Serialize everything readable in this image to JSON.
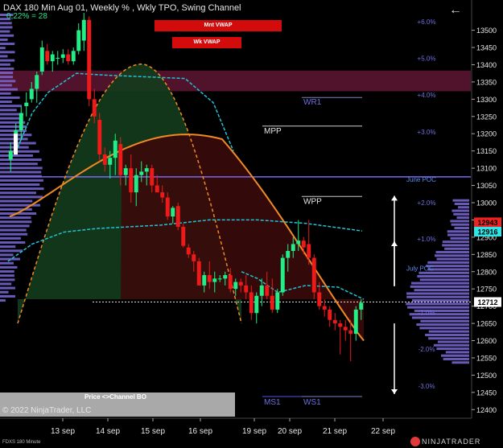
{
  "header": {
    "title": "DAX  180 Min Aug 01, Weekly % , Wkly TPO, Swing Channel",
    "subtitle": "0,22% = 28"
  },
  "buttons": {
    "mnt_vwap": "Mnt VWAP",
    "wk_vwap": "Wk VWAP"
  },
  "footer": {
    "copyright": "© 2022 NinjaTrader, LLC",
    "instrument": "FDXS 180 Minute",
    "brand": "NINJATRADER",
    "panel_label": "Price <>Channel BO"
  },
  "colors": {
    "bull": "#22ee88",
    "bear": "#ee1a1a",
    "vwap": "#25c2d6",
    "channel": "#f08a24",
    "profile": "#7b68d8",
    "zone_top": "#6b1a3a",
    "green_fill": "#133c1c",
    "red_fill": "#3a0a0a"
  },
  "chart_data": {
    "type": "candlestick",
    "x_ticks": [
      "13 sep",
      "14 sep",
      "15 sep",
      "16 sep",
      "19 sep",
      "20 sep",
      "21 sep",
      "22 sep"
    ],
    "y_ticks": [
      13500,
      13450,
      13400,
      13350,
      13300,
      13250,
      13200,
      13150,
      13100,
      13050,
      13000,
      12950,
      12900,
      12850,
      12800,
      12750,
      12700,
      12650,
      12600,
      12550,
      12500,
      12450,
      12400
    ],
    "ylim": [
      12375,
      13555
    ],
    "pct_levels": [
      {
        "label": "+6.0%",
        "value": 13525
      },
      {
        "label": "+5.0%",
        "value": 13418
      },
      {
        "label": "+4.0%",
        "value": 13312
      },
      {
        "label": "+3.0%",
        "value": 13205
      },
      {
        "label": "+2.0%",
        "value": 13000
      },
      {
        "label": "+1.0%",
        "value": 12895
      },
      {
        "label": "-1.0%",
        "value": 12682
      },
      {
        "label": "-2.0%",
        "value": 12575
      },
      {
        "label": "-3.0%",
        "value": 12468
      }
    ],
    "annotations": {
      "june_poc": {
        "label": "June POC",
        "value": 13068
      },
      "july_poc": {
        "label": "July POC",
        "value": 12810
      }
    },
    "levels": [
      {
        "label": "WR1",
        "value": 13305
      },
      {
        "label": "MPP",
        "value": 13222
      },
      {
        "label": "WPP",
        "value": 13018
      },
      {
        "label": "MS1",
        "value": 12438
      },
      {
        "label": "WS1",
        "value": 12438
      }
    ],
    "price_tags": [
      {
        "label": "12943",
        "value": 12943,
        "color": "#ee2222"
      },
      {
        "label": "12916",
        "value": 12916,
        "color": "#2ee6e6"
      },
      {
        "label": "12712",
        "value": 12712,
        "color": "#ffffff"
      }
    ],
    "purple_line": 13075,
    "zone": [
      13323,
      13383
    ],
    "last_price": 12712,
    "candles": [
      {
        "o": 13125,
        "h": 13175,
        "l": 13090,
        "c": 13150
      },
      {
        "o": 13155,
        "h": 13230,
        "l": 13150,
        "c": 13210
      },
      {
        "o": 13210,
        "h": 13280,
        "l": 13180,
        "c": 13260
      },
      {
        "o": 13280,
        "h": 13320,
        "l": 13250,
        "c": 13290
      },
      {
        "o": 13300,
        "h": 13350,
        "l": 13290,
        "c": 13330
      },
      {
        "o": 13330,
        "h": 13380,
        "l": 13290,
        "c": 13370
      },
      {
        "o": 13380,
        "h": 13470,
        "l": 13370,
        "c": 13450
      },
      {
        "o": 13440,
        "h": 13460,
        "l": 13400,
        "c": 13410
      },
      {
        "o": 13410,
        "h": 13440,
        "l": 13380,
        "c": 13430
      },
      {
        "o": 13420,
        "h": 13440,
        "l": 13400,
        "c": 13420
      },
      {
        "o": 13420,
        "h": 13445,
        "l": 13405,
        "c": 13430
      },
      {
        "o": 13430,
        "h": 13445,
        "l": 13400,
        "c": 13410
      },
      {
        "o": 13410,
        "h": 13450,
        "l": 13400,
        "c": 13440
      },
      {
        "o": 13440,
        "h": 13520,
        "l": 13430,
        "c": 13500
      },
      {
        "o": 13470,
        "h": 13550,
        "l": 13440,
        "c": 13530
      },
      {
        "o": 13530,
        "h": 13540,
        "l": 13280,
        "c": 13300
      },
      {
        "o": 13300,
        "h": 13330,
        "l": 13230,
        "c": 13250
      },
      {
        "o": 13240,
        "h": 13260,
        "l": 13120,
        "c": 13140
      },
      {
        "o": 13140,
        "h": 13160,
        "l": 13090,
        "c": 13110
      },
      {
        "o": 13110,
        "h": 13150,
        "l": 13070,
        "c": 13130
      },
      {
        "o": 13130,
        "h": 13200,
        "l": 13080,
        "c": 13180
      },
      {
        "o": 13170,
        "h": 13190,
        "l": 13050,
        "c": 13080
      },
      {
        "o": 13080,
        "h": 13110,
        "l": 13050,
        "c": 13100
      },
      {
        "o": 13100,
        "h": 13140,
        "l": 13000,
        "c": 13030
      },
      {
        "o": 13030,
        "h": 13100,
        "l": 12990,
        "c": 13080
      },
      {
        "o": 13080,
        "h": 13120,
        "l": 13060,
        "c": 13090
      },
      {
        "o": 13090,
        "h": 13110,
        "l": 13050,
        "c": 13100
      },
      {
        "o": 13100,
        "h": 13110,
        "l": 13030,
        "c": 13050
      },
      {
        "o": 13050,
        "h": 13080,
        "l": 13030,
        "c": 13030
      },
      {
        "o": 13030,
        "h": 13050,
        "l": 13000,
        "c": 13015
      },
      {
        "o": 13015,
        "h": 13030,
        "l": 12950,
        "c": 12960
      },
      {
        "o": 12960,
        "h": 12990,
        "l": 12940,
        "c": 12985
      },
      {
        "o": 12990,
        "h": 13000,
        "l": 12920,
        "c": 12930
      },
      {
        "o": 12930,
        "h": 12940,
        "l": 12870,
        "c": 12875
      },
      {
        "o": 12870,
        "h": 12880,
        "l": 12840,
        "c": 12850
      },
      {
        "o": 12850,
        "h": 12860,
        "l": 12800,
        "c": 12830
      },
      {
        "o": 12830,
        "h": 12840,
        "l": 12760,
        "c": 12760
      },
      {
        "o": 12760,
        "h": 12800,
        "l": 12740,
        "c": 12790
      },
      {
        "o": 12790,
        "h": 12830,
        "l": 12750,
        "c": 12770
      },
      {
        "o": 12770,
        "h": 12800,
        "l": 12740,
        "c": 12780
      },
      {
        "o": 12780,
        "h": 12790,
        "l": 12770,
        "c": 12780
      },
      {
        "o": 12780,
        "h": 12800,
        "l": 12760,
        "c": 12790
      },
      {
        "o": 12790,
        "h": 12810,
        "l": 12740,
        "c": 12750
      },
      {
        "o": 12750,
        "h": 12780,
        "l": 12730,
        "c": 12770
      },
      {
        "o": 12770,
        "h": 12780,
        "l": 12740,
        "c": 12760
      },
      {
        "o": 12760,
        "h": 12790,
        "l": 12720,
        "c": 12740
      },
      {
        "o": 12740,
        "h": 12760,
        "l": 12660,
        "c": 12680
      },
      {
        "o": 12680,
        "h": 12740,
        "l": 12650,
        "c": 12730
      },
      {
        "o": 12730,
        "h": 12780,
        "l": 12700,
        "c": 12760
      },
      {
        "o": 12760,
        "h": 12800,
        "l": 12720,
        "c": 12730
      },
      {
        "o": 12730,
        "h": 12780,
        "l": 12680,
        "c": 12690
      },
      {
        "o": 12690,
        "h": 12750,
        "l": 12680,
        "c": 12740
      },
      {
        "o": 12740,
        "h": 12850,
        "l": 12730,
        "c": 12840
      },
      {
        "o": 12840,
        "h": 12880,
        "l": 12800,
        "c": 12860
      },
      {
        "o": 12860,
        "h": 12900,
        "l": 12840,
        "c": 12880
      },
      {
        "o": 12880,
        "h": 12950,
        "l": 12860,
        "c": 12890
      },
      {
        "o": 12890,
        "h": 12900,
        "l": 12850,
        "c": 12870
      },
      {
        "o": 12880,
        "h": 12950,
        "l": 12820,
        "c": 12840
      },
      {
        "o": 12840,
        "h": 12850,
        "l": 12720,
        "c": 12740
      },
      {
        "o": 12740,
        "h": 12770,
        "l": 12690,
        "c": 12700
      },
      {
        "o": 12700,
        "h": 12720,
        "l": 12670,
        "c": 12690
      },
      {
        "o": 12690,
        "h": 12700,
        "l": 12640,
        "c": 12660
      },
      {
        "o": 12660,
        "h": 12680,
        "l": 12630,
        "c": 12650
      },
      {
        "o": 12650,
        "h": 12660,
        "l": 12560,
        "c": 12640
      },
      {
        "o": 12640,
        "h": 12660,
        "l": 12600,
        "c": 12630
      },
      {
        "o": 12630,
        "h": 12660,
        "l": 12540,
        "c": 12620
      },
      {
        "o": 12620,
        "h": 12700,
        "l": 12600,
        "c": 12690
      },
      {
        "o": 12690,
        "h": 12720,
        "l": 12660,
        "c": 12710
      }
    ]
  }
}
